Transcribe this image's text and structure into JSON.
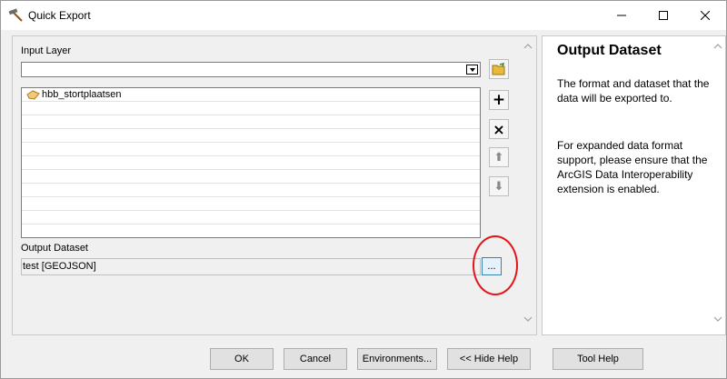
{
  "window": {
    "title": "Quick Export",
    "controls": {
      "minimize": "—",
      "maximize": "☐",
      "close": "✕"
    }
  },
  "form": {
    "input_layer_label": "Input Layer",
    "input_layer_value": "",
    "layers": [
      "hbb_stortplaatsen",
      "",
      "",
      "",
      "",
      "",
      "",
      "",
      "",
      ""
    ],
    "output_dataset_label": "Output Dataset",
    "output_dataset_value": "test [GEOJSON]",
    "browse_label": "..."
  },
  "side_buttons": {
    "add": "+",
    "remove": "×",
    "up": "⬆",
    "down": "⬇"
  },
  "help": {
    "title": "Output Dataset",
    "paragraph1": "The format and dataset that the data will be exported to.",
    "paragraph2": "For expanded data format support, please ensure that the ArcGIS Data Interoperability extension is enabled."
  },
  "buttons": {
    "ok": "OK",
    "cancel": "Cancel",
    "environments": "Environments...",
    "hide_help": "<< Hide Help",
    "tool_help": "Tool Help"
  },
  "colors": {
    "highlight_circle": "#e3151a",
    "browse_border": "#3c7fb1"
  }
}
